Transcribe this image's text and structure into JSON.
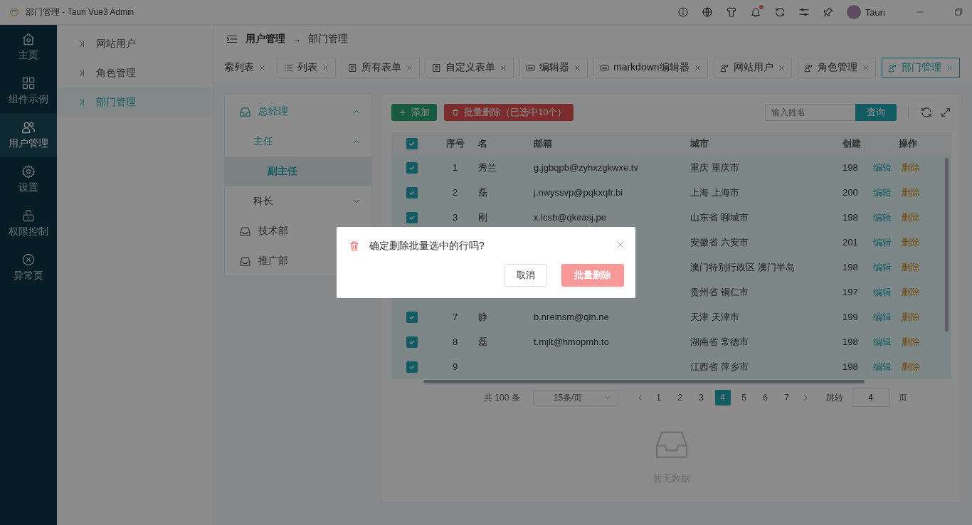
{
  "window": {
    "title": "部门管理 - Tauri Vue3 Admin",
    "user": "Tauri"
  },
  "rail": [
    {
      "label": "主页",
      "selected": false
    },
    {
      "label": "组件示例",
      "selected": false
    },
    {
      "label": "用户管理",
      "selected": true
    },
    {
      "label": "设置",
      "selected": false
    },
    {
      "label": "权限控制",
      "selected": false
    },
    {
      "label": "异常页",
      "selected": false
    }
  ],
  "submenu": [
    {
      "label": "网站用户",
      "selected": false
    },
    {
      "label": "角色管理",
      "selected": false
    },
    {
      "label": "部门管理",
      "selected": true
    }
  ],
  "breadcrumb": [
    "用户管理",
    "→",
    "部门管理"
  ],
  "tabs": [
    {
      "label": "索列表",
      "selected": false
    },
    {
      "label": "列表",
      "selected": false
    },
    {
      "label": "所有表单",
      "selected": false
    },
    {
      "label": "自定义表单",
      "selected": false
    },
    {
      "label": "编辑器",
      "selected": false
    },
    {
      "label": "markdown编辑器",
      "selected": false
    },
    {
      "label": "网站用户",
      "selected": false
    },
    {
      "label": "角色管理",
      "selected": false
    },
    {
      "label": "部门管理",
      "selected": true
    }
  ],
  "tree": [
    {
      "label": "总经理",
      "expanded": true,
      "selected": false,
      "children": [
        {
          "label": "主任",
          "expanded": true,
          "selected": false,
          "children": [
            {
              "label": "副主任",
              "selected": true
            }
          ]
        },
        {
          "label": "科长",
          "expanded": false,
          "selected": false
        }
      ]
    },
    {
      "label": "技术部",
      "selected": false
    },
    {
      "label": "推广部",
      "selected": false
    }
  ],
  "toolbar": {
    "add": "添加",
    "batch_delete": "批量删除（已选中10个）",
    "search": {
      "placeholder": "输入姓名"
    },
    "query": "查询"
  },
  "table": {
    "all_checked": true,
    "columns": [
      "序号",
      "名",
      "邮箱",
      "城市",
      "创建",
      "操作"
    ],
    "rows": [
      {
        "checked": true,
        "seq": "1",
        "name": "秀兰",
        "email": "g.jgbqpb@zyhxzgkwxe.tv",
        "city": "重庆 重庆市",
        "created": "198",
        "actions": [
          "编辑",
          "删除"
        ]
      },
      {
        "checked": true,
        "seq": "2",
        "name": "磊",
        "email": "j.nwyssvp@pqkxqfr.bi",
        "city": "上海 上海市",
        "created": "200",
        "actions": [
          "编辑",
          "删除"
        ]
      },
      {
        "checked": true,
        "seq": "3",
        "name": "刚",
        "email": "x.lcsb@qkeasj.pe",
        "city": "山东省 聊城市",
        "created": "198",
        "actions": [
          "编辑",
          "删除"
        ]
      },
      {
        "city": "安徽省 六安市",
        "created": "201",
        "actions": [
          "编辑",
          "删除"
        ]
      },
      {
        "city": "澳门特别行政区 澳门半岛",
        "created": "198",
        "actions": [
          "编辑",
          "删除"
        ]
      },
      {
        "city": "贵州省 铜仁市",
        "created": "197",
        "actions": [
          "编辑",
          "删除"
        ]
      },
      {
        "checked": true,
        "seq": "7",
        "name": "静",
        "email": "b.nreinsm@qln.ne",
        "city": "天津 天津市",
        "created": "199",
        "actions": [
          "编辑",
          "删除"
        ]
      },
      {
        "checked": true,
        "seq": "8",
        "name": "磊",
        "email": "t.mjlt@hmopmh.to",
        "city": "湖南省 常德市",
        "created": "198",
        "actions": [
          "编辑",
          "删除"
        ]
      },
      {
        "checked": true,
        "seq": "9",
        "city": "江西省 萍乡市",
        "created": "198",
        "actions": [
          "编辑",
          "删除"
        ]
      }
    ]
  },
  "pagination": {
    "total": "共 100 条",
    "page_size": "15条/页",
    "pages": [
      {
        "label": "1",
        "selected": false
      },
      {
        "label": "2",
        "selected": false
      },
      {
        "label": "3",
        "selected": false
      },
      {
        "label": "4",
        "selected": true
      },
      {
        "label": "5",
        "selected": false
      },
      {
        "label": "6",
        "selected": false
      },
      {
        "label": "7",
        "selected": false
      }
    ],
    "jump_label": "跳转",
    "jump_value": "4",
    "jump_unit": "页"
  },
  "empty": "暂无数据",
  "dialog": {
    "message": "确定删除批量选中的行吗?",
    "cancel": "取消",
    "confirm": "批量删除"
  }
}
